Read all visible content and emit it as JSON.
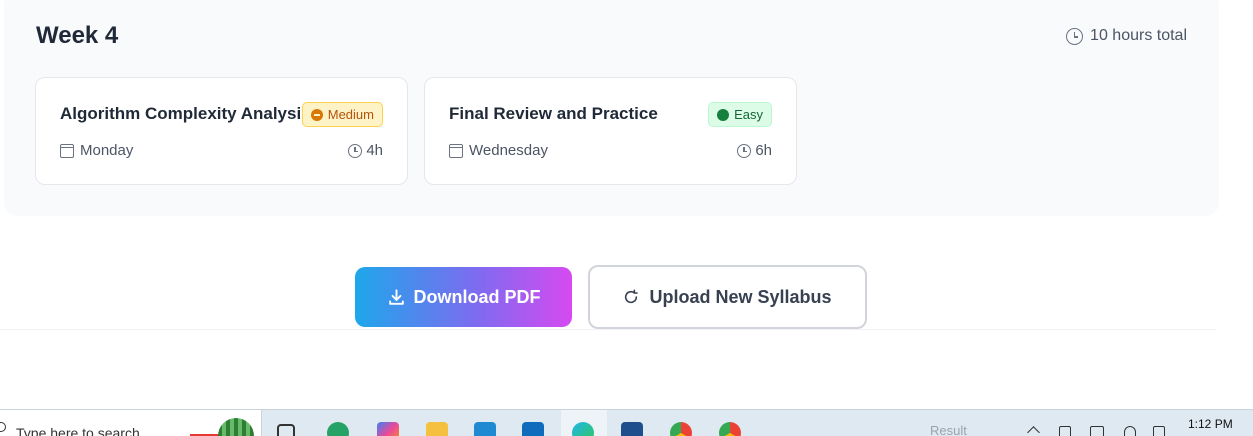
{
  "week": {
    "title": "Week 4",
    "total": "10 hours total"
  },
  "sessions": [
    {
      "title": "Algorithm Complexity Analysis",
      "difficulty": "Medium",
      "day": "Monday",
      "hours": "4h"
    },
    {
      "title": "Final Review and Practice",
      "difficulty": "Easy",
      "day": "Wednesday",
      "hours": "6h"
    }
  ],
  "actions": {
    "download": "Download PDF",
    "upload": "Upload New Syllabus"
  },
  "taskbar": {
    "search_placeholder": "Type here to search",
    "faded_widget": "Result",
    "time": "1:12 PM",
    "apps": [
      "task-view",
      "whatsapp",
      "copilot",
      "file-explorer",
      "vscode",
      "outlook",
      "edge",
      "microsoft-store",
      "chrome",
      "chrome-profile"
    ]
  },
  "colors": {
    "medium_badge": "#fef3c7",
    "easy_badge": "#dcfce7",
    "download_gradient_start": "#1ea7ea",
    "download_gradient_end": "#d64af0"
  }
}
